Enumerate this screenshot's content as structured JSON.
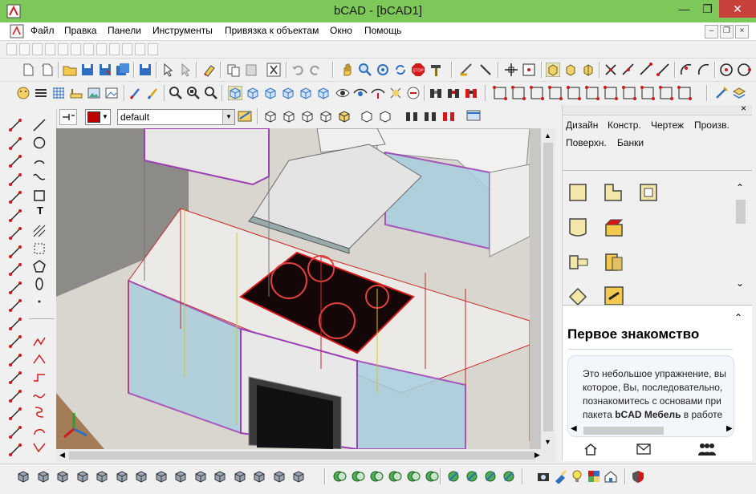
{
  "window": {
    "title": "bCAD - [bCAD1]",
    "minimize_glyph": "—",
    "maximize_glyph": "❐",
    "close_glyph": "✕"
  },
  "menu": {
    "items": [
      "Файл",
      "Правка",
      "Панели",
      "Инструменты",
      "Привязка к объектам",
      "Окно",
      "Помощь"
    ]
  },
  "mdi_controls": [
    "‒",
    "❐",
    "×"
  ],
  "property_bar": {
    "color_value": "#c00000",
    "layer_value": "default"
  },
  "right_panel": {
    "close_glyph": "×",
    "tabs_row1": [
      "Дизайн",
      "Констр.",
      "Чертеж",
      "Произв."
    ],
    "tabs_row2": [
      "Поверхн.",
      "Банки"
    ],
    "help_title": "Первое знакомство",
    "help_lines": [
      "Это небольшое упражнение, вы",
      "которое, Вы, последовательно,",
      "познакомитесь с основами при",
      "пакета "
    ],
    "help_bold": "bCAD Мебель",
    "help_tail": " в работе",
    "footer_icons": [
      "home-icon",
      "mail-icon",
      "users-icon"
    ]
  },
  "left_toolbar": {
    "text_tool": "T"
  },
  "colors": {
    "titlebar": "#7ec85a",
    "close": "#c7403a",
    "accent_red": "#d21818",
    "icon_blue": "#2f6fc0",
    "icon_yellow": "#f2d06a",
    "wall": "#8a8a86",
    "cabinet_glass": "#a9cfe0",
    "counter": "#e8e6e2",
    "floor": "#a88060"
  }
}
